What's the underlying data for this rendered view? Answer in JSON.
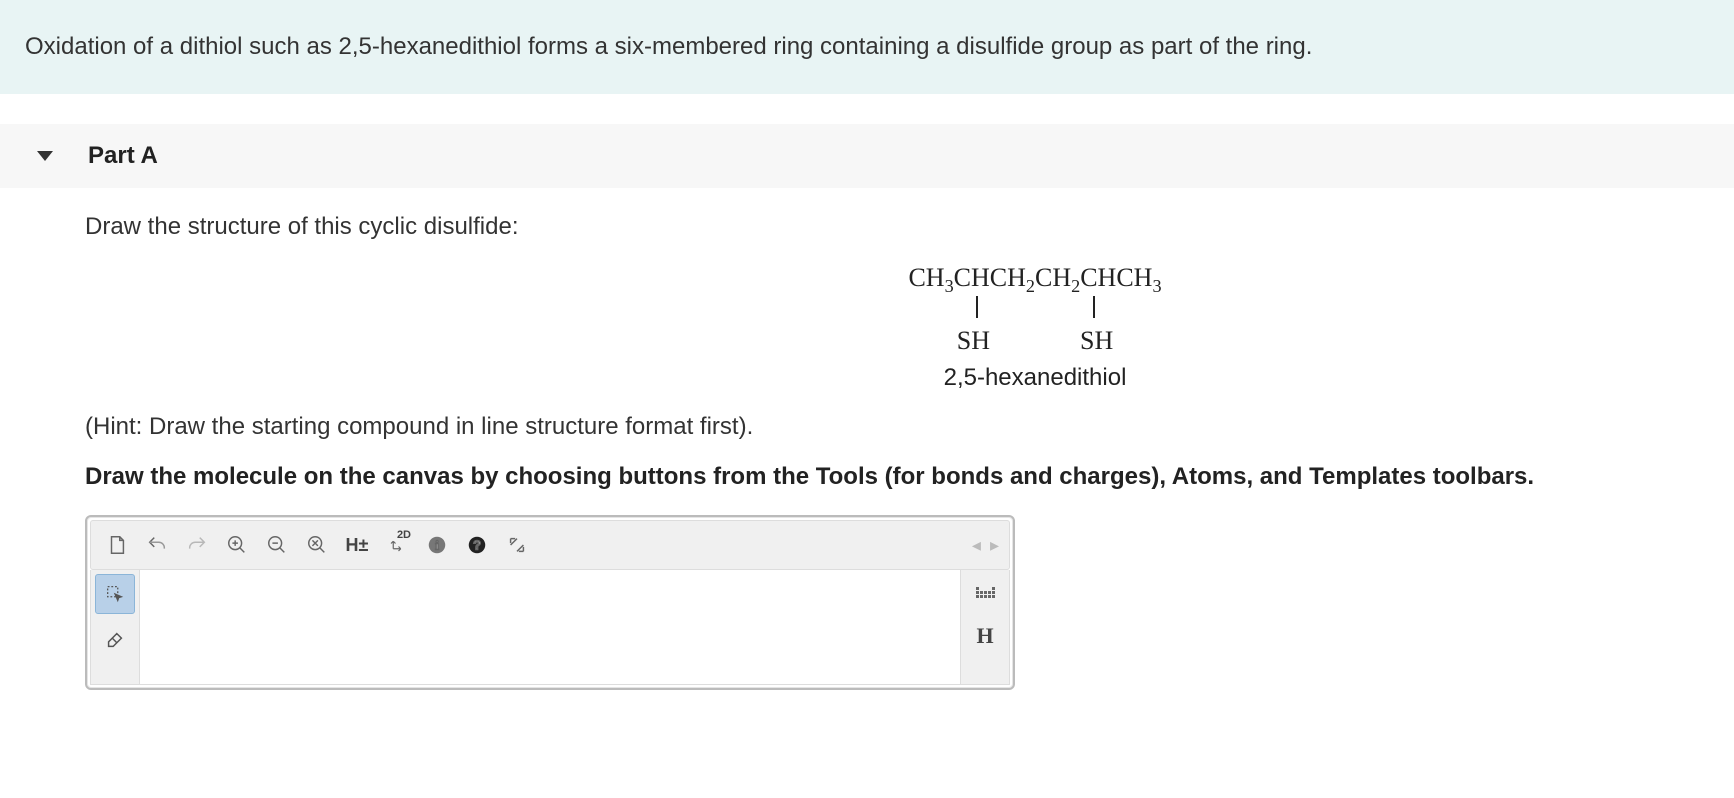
{
  "intro": "Oxidation of a dithiol such as 2,5-hexanedithiol forms a six-membered ring containing a disulfide group as part of the ring.",
  "part_label": "Part A",
  "prompt": "Draw the structure of this cyclic disulfide:",
  "formula": {
    "line1_html": "CH<sub>3</sub>CHCH<sub>2</sub>CH<sub>2</sub>CHCH<sub>3</sub>",
    "sh1": "SH",
    "sh2": "SH",
    "name": "2,5-hexanedithiol"
  },
  "hint": "(Hint: Draw the starting compound in line structure format first).",
  "instruction": "Draw the molecule on the canvas by choosing buttons from the Tools (for bonds and charges), Atoms, and Templates toolbars.",
  "toolbar": {
    "h_toggle": "H±",
    "view_2d": "2D",
    "nav": "◂ ▸"
  },
  "right_panel": {
    "hydrogen": "H"
  }
}
